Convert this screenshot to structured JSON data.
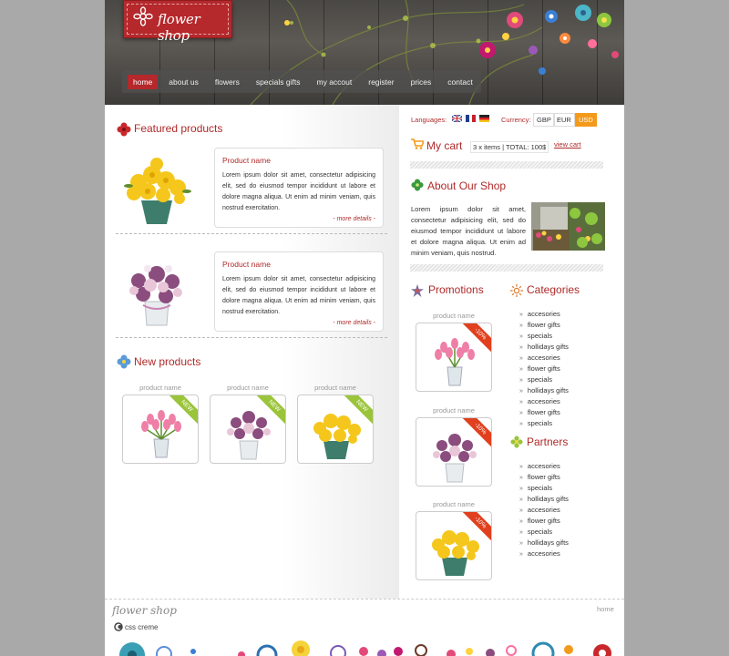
{
  "brand": {
    "name": "flower shop"
  },
  "nav": {
    "items": [
      {
        "label": "home",
        "active": true
      },
      {
        "label": "about us"
      },
      {
        "label": "flowers"
      },
      {
        "label": "specials gifts"
      },
      {
        "label": "my accout"
      },
      {
        "label": "register"
      },
      {
        "label": "prices"
      },
      {
        "label": "contact"
      }
    ]
  },
  "featured": {
    "title": "Featured products",
    "products": [
      {
        "name": "Product name",
        "desc": "Lorem ipsum dolor sit amet, consectetur adipisicing elit, sed do eiusmod tempor incididunt ut labore et dolore magna aliqua. Ut enim ad minim veniam, quis nostrud exercitation.",
        "more": "- more details -"
      },
      {
        "name": "Product name",
        "desc": "Lorem ipsum dolor sit amet, consectetur adipisicing elit, sed do eiusmod tempor incididunt ut labore et dolore magna aliqua. Ut enim ad minim veniam, quis nostrud exercitation.",
        "more": "- more details -"
      }
    ]
  },
  "new_products": {
    "title": "New products",
    "items": [
      {
        "label": "product name",
        "badge": "NEW"
      },
      {
        "label": "product name",
        "badge": "NEW"
      },
      {
        "label": "product name",
        "badge": "NEW"
      }
    ]
  },
  "languages": {
    "label": "Languages:"
  },
  "currency": {
    "label": "Currency:",
    "options": [
      "GBP",
      "EUR",
      "USD"
    ],
    "selected": "USD"
  },
  "cart": {
    "title": "My cart",
    "summary": "3 x items | TOTAL: 100$",
    "link": "view cart"
  },
  "about": {
    "title": "About Our Shop",
    "text": "Lorem ipsum dolor sit amet, consectetur adipisicing elit, sed do eiusmod tempor incididunt ut labore et dolore magna aliqua. Ut enim ad minim veniam, quis nostrud."
  },
  "promotions": {
    "title": "Promotions",
    "items": [
      {
        "label": "product name",
        "badge": "-10%"
      },
      {
        "label": "product name",
        "badge": "-10%"
      },
      {
        "label": "product name",
        "badge": "-10%"
      }
    ]
  },
  "categories": {
    "title": "Categories",
    "items": [
      "accesories",
      "flower gifts",
      "specials",
      "hollidays gifts",
      "accesories",
      "flower gifts",
      "specials",
      "hollidays gifts",
      "accesories",
      "flower gifts",
      "specials"
    ]
  },
  "partners": {
    "title": "Partners",
    "items": [
      "accesories",
      "flower gifts",
      "specials",
      "hollidays gifts",
      "accesories",
      "flower gifts",
      "specials",
      "hollidays gifts",
      "accesories"
    ]
  },
  "footer": {
    "brand": "flower shop",
    "credit": "css creme",
    "link": "home"
  },
  "colors": {
    "accent": "#b5282b",
    "orange": "#f39a1b",
    "new_ribbon": "#9ac43a",
    "sale_ribbon": "#e0401e"
  }
}
